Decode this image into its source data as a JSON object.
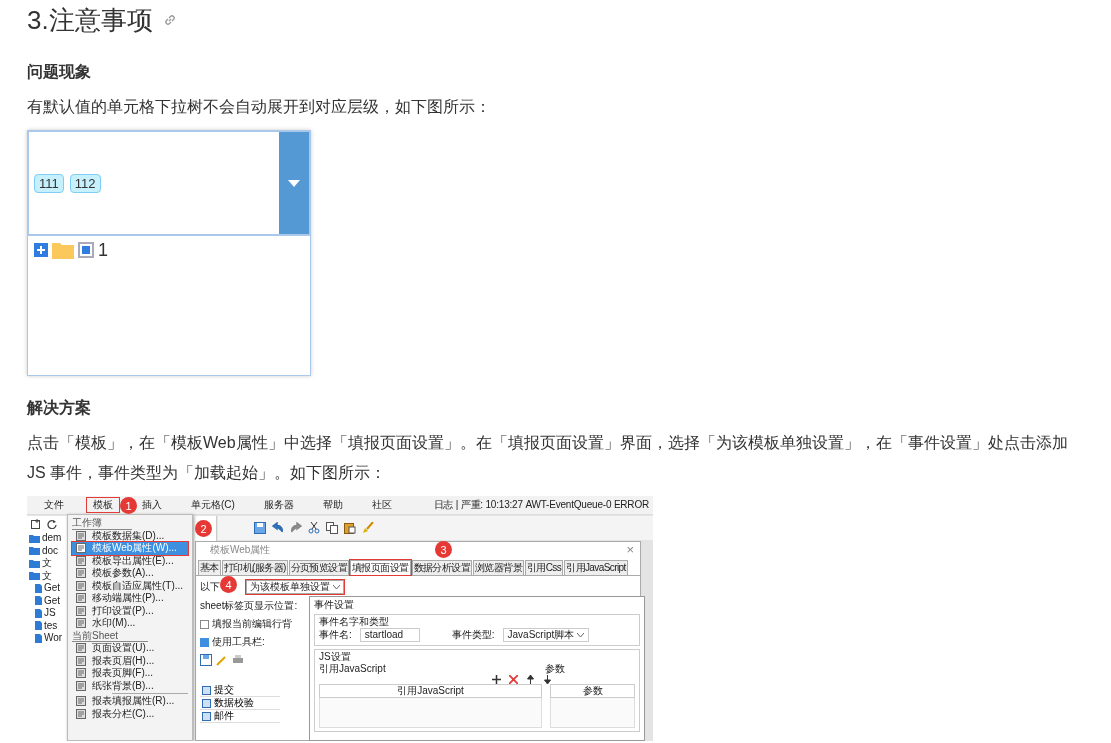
{
  "heading": {
    "text": "3.注意事项"
  },
  "problem": {
    "title": "问题现象",
    "text": "有默认值的单元格下拉树不会自动展开到对应层级，如下图所示：",
    "figure": {
      "tags": [
        "111",
        "112"
      ],
      "tree": [
        {
          "label": "1",
          "expanded": false,
          "partial": true
        }
      ]
    }
  },
  "solution": {
    "title": "解决方案",
    "text": "点击「模板」，在「模板Web属性」中选择「填报页面设置」。在「填报页面设置」界面，选择「为该模板单独设置」，在「事件设置」处点击添加 JS 事件，事件类型为「加载起始」。如下图所示：",
    "figure": {
      "menubar": [
        {
          "label": "文件",
          "highlighted": false
        },
        {
          "label": "模板",
          "highlighted": true
        },
        {
          "label": "插入",
          "highlighted": false
        },
        {
          "label": "单元格(C)",
          "highlighted": false
        },
        {
          "label": "服务器",
          "highlighted": false
        },
        {
          "label": "帮助",
          "highlighted": false
        },
        {
          "label": "社区",
          "highlighted": false
        }
      ],
      "log": "日志 | 严重: 10:13:27 AWT-EventQueue-0 ERROR",
      "tree": [
        {
          "label": "dem",
          "kind": "folder"
        },
        {
          "label": "doc",
          "kind": "folder"
        },
        {
          "label": "文",
          "kind": "folder"
        },
        {
          "label": "文",
          "kind": "folder"
        },
        {
          "label": "Get",
          "kind": "file"
        },
        {
          "label": "Get",
          "kind": "file"
        },
        {
          "label": "JS",
          "kind": "file"
        },
        {
          "label": "tes",
          "kind": "file"
        },
        {
          "label": "Wor",
          "kind": "file"
        }
      ],
      "menu": [
        {
          "title": "工作簿",
          "items": [
            {
              "label": "模板数据集(D)...",
              "selected": false
            },
            {
              "label": "模板Web属性(W)...",
              "selected": true
            },
            {
              "label": "模板导出属性(E)...",
              "selected": false
            },
            {
              "label": "模板参数(A)...",
              "selected": false
            },
            {
              "label": "模板自适应属性(T)...",
              "selected": false
            },
            {
              "label": "移动端属性(P)...",
              "selected": false
            },
            {
              "label": "打印设置(P)...",
              "selected": false
            },
            {
              "label": "水印(M)...",
              "selected": false
            }
          ]
        },
        {
          "title": "当前Sheet",
          "items": [
            {
              "label": "页面设置(U)...",
              "selected": false
            },
            {
              "label": "报表页眉(H)...",
              "selected": false
            },
            {
              "label": "报表页脚(F)...",
              "selected": false
            },
            {
              "label": "纸张背景(B)...",
              "selected": false
            },
            {
              "label": "报表填报属性(R)...",
              "selected": false
            },
            {
              "label": "报表分栏(C)...",
              "selected": false
            }
          ]
        }
      ],
      "badges": [
        "1",
        "2",
        "3",
        "4"
      ],
      "dialog": {
        "title": "模板Web属性",
        "close": "×",
        "tabs": [
          {
            "label": "基本",
            "selected": false
          },
          {
            "label": "打印机(服务器)",
            "selected": false
          },
          {
            "label": "分页预览设置",
            "selected": false
          },
          {
            "label": "填报页面设置",
            "selected": true
          },
          {
            "label": "数据分析设置",
            "selected": false
          },
          {
            "label": "浏览器背景",
            "selected": false
          },
          {
            "label": "引用Css",
            "selected": false
          },
          {
            "label": "引用JavaScript",
            "selected": false
          }
        ],
        "setting_label": "以下",
        "setting_value": "为该模板单独设置",
        "sheet_label": "sheet标签页显示位置:",
        "options": [
          {
            "label": "填报当前编辑行背",
            "checked": false
          },
          {
            "label": "使用工具栏:",
            "checked": true
          }
        ],
        "buttons": [
          "提交",
          "数据校验",
          "邮件"
        ]
      },
      "event_dialog": {
        "title": "事件设置",
        "group1": "事件名字和类型",
        "name_label": "事件名:",
        "name_value": "startload",
        "type_label": "事件类型:",
        "type_value": "JavaScript脚本",
        "group2": "JS设置",
        "ref_label": "引用JavaScript",
        "param_label": "参数",
        "columns": [
          "引用JavaScript",
          "参数"
        ]
      }
    }
  }
}
